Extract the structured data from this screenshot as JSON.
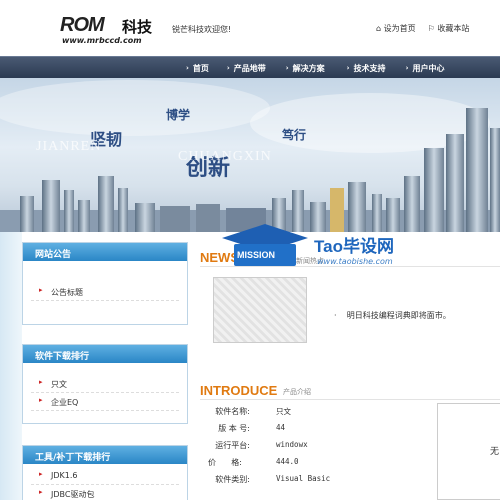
{
  "header": {
    "logo_text": "ROM",
    "logo_cn": "科技",
    "logo_url": "www.mrbccd.com",
    "welcome": "锐芒科技欢迎您!",
    "links": [
      "设为首页",
      "收藏本站"
    ]
  },
  "nav": {
    "items": [
      "首页",
      "产品地带",
      "解决方案",
      "技术支持",
      "用户中心"
    ]
  },
  "banner": {
    "phrases": [
      "博学",
      "坚韧",
      "创新",
      "笃行"
    ],
    "ghost_text": [
      "JIANREN",
      "CHUANGXIN"
    ]
  },
  "sidebar": {
    "notice": {
      "title": "网站公告",
      "items": [
        "公告标题"
      ]
    },
    "download_rank": {
      "title": "软件下载排行",
      "items": [
        "只文",
        "企业EQ"
      ]
    },
    "tools_rank": {
      "title": "工具/补丁下载排行",
      "items": [
        "JDK1.6",
        "JDBC驱动包"
      ]
    }
  },
  "watermark": {
    "badge": "MISSION",
    "title": "Tao毕设网",
    "url": "www.taobishe.com"
  },
  "news": {
    "title": "NEWS",
    "subtitle": "新闻热点",
    "items": [
      "明日科技编程词典即将面市。"
    ]
  },
  "intro": {
    "title": "INTRODUCE",
    "subtitle": "产品介绍",
    "specs": [
      {
        "key": "软件名称:",
        "value": "只文"
      },
      {
        "key": "版 本 号:",
        "value": "44"
      },
      {
        "key": "运行平台:",
        "value": "windowx"
      },
      {
        "key": "价      格:",
        "value": "444.0"
      },
      {
        "key": "软件类别:",
        "value": "Visual Basic"
      }
    ],
    "panel_text": "无"
  }
}
